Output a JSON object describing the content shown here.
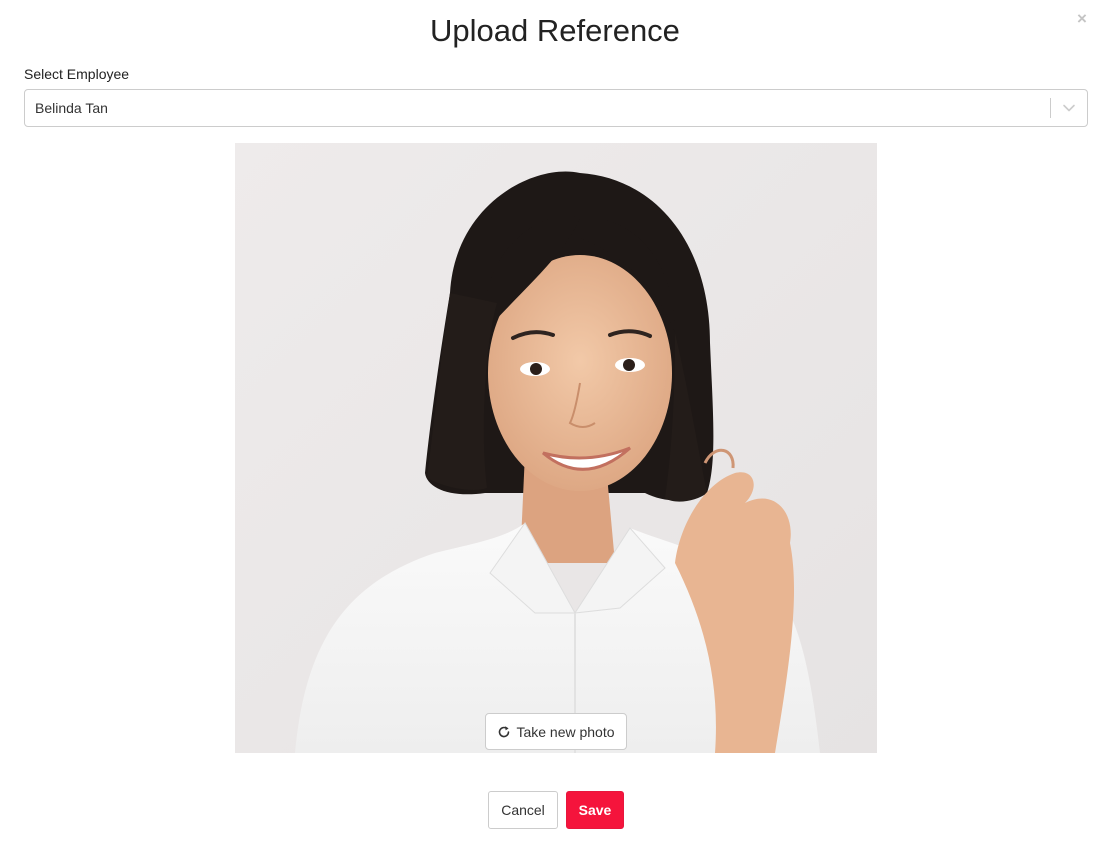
{
  "modal": {
    "title": "Upload Reference",
    "close_label": "×"
  },
  "employee_select": {
    "label": "Select Employee",
    "value": "Belinda Tan",
    "icon": "chevron-down-icon"
  },
  "photo": {
    "alt": "Reference photo of Belinda Tan"
  },
  "retake_button": {
    "label": "Take new photo",
    "icon": "refresh-icon"
  },
  "footer": {
    "cancel_label": "Cancel",
    "save_label": "Save"
  },
  "colors": {
    "accent": "#f5143c",
    "border": "#cccccc",
    "photo_background": "#ebe8e8"
  }
}
